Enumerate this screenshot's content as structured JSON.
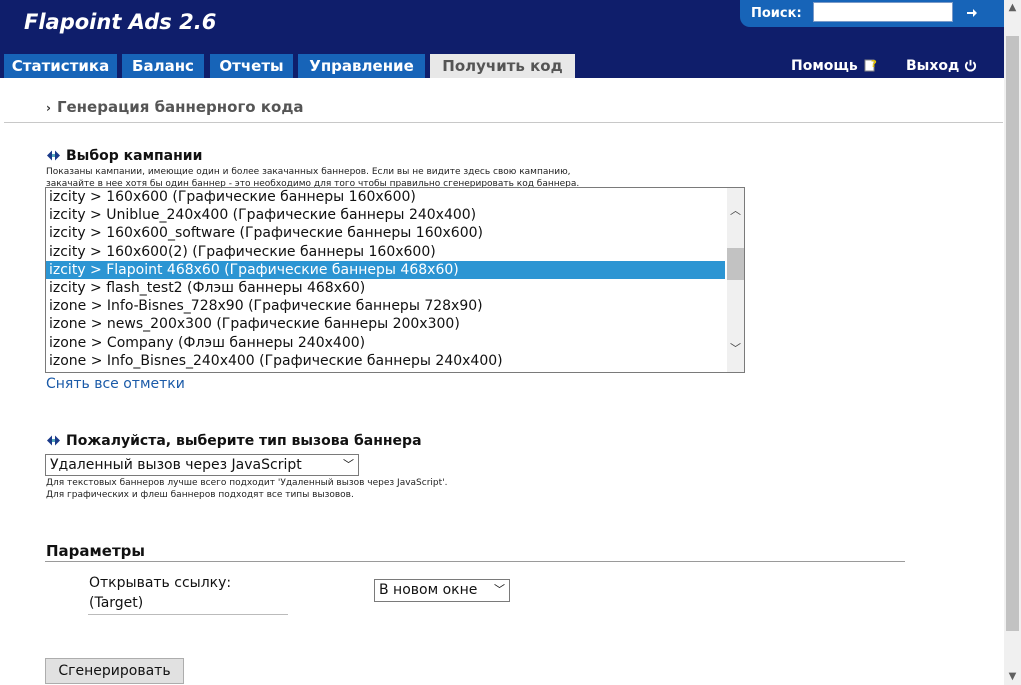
{
  "header": {
    "app_title": "Flapoint Ads 2.6",
    "search_label": "Поиск:",
    "search_value": "",
    "help_label": "Помощь",
    "exit_label": "Выход",
    "tabs": [
      {
        "label": "Статистика",
        "active": false
      },
      {
        "label": "Баланс",
        "active": false
      },
      {
        "label": "Отчеты",
        "active": false
      },
      {
        "label": "Управление",
        "active": false
      },
      {
        "label": "Получить код",
        "active": true
      }
    ]
  },
  "breadcrumb": "Генерация баннерного кода",
  "campaign": {
    "title": "Выбор кампании",
    "note_line1": "Показаны кампании, имеющие один и более закачанных баннеров. Если вы не видите здесь свою кампанию,",
    "note_line2": "закачайте в нее хотя бы один баннер - это необходимо для того чтобы правильно сгенерировать код баннера.",
    "options": [
      "izcity > 160x600   (Графические баннеры 160x600)",
      "izcity > Uniblue_240x400   (Графические баннеры 240x400)",
      "izcity > 160x600_software   (Графические баннеры 160x600)",
      "izcity > 160x600(2)   (Графические баннеры 160x600)",
      "izcity > Flapoint 468x60   (Графические баннеры 468x60)",
      "izcity > flash_test2   (Флэш баннеры 468x60)",
      "izone > Info-Bisnes_728x90   (Графические баннеры 728x90)",
      "izone > news_200x300   (Графические баннеры 200x300)",
      "izone > Company   (Флэш баннеры 240x400)",
      "izone > Info_Bisnes_240x400   (Графические баннеры 240x400)"
    ],
    "selected_index": 4,
    "clear_link": "Снять все отметки"
  },
  "call_type": {
    "title": "Пожалуйста, выберите тип вызова баннера",
    "selected": "Удаленный вызов через JavaScript",
    "note_line1": "Для текстовых баннеров лучше всего подходит 'Удаленный вызов через JavaScript'.",
    "note_line2": "Для графических и флеш баннеров подходят все типы вызовов."
  },
  "params": {
    "title": "Параметры",
    "target_label_1": "Открывать ссылку:",
    "target_label_2": "(Target)",
    "target_selected": "В новом окне"
  },
  "generate_button": "Сгенерировать",
  "colors": {
    "header_bg": "#0f1e6b",
    "tab_bg": "#1764b8",
    "selected_row": "#2c95d3",
    "link": "#1a5aa8"
  }
}
